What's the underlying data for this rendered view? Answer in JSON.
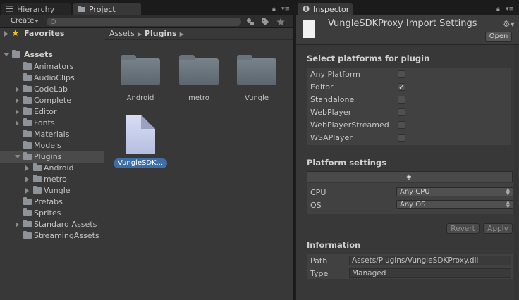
{
  "left_panel": {
    "tabs": [
      {
        "label": "Hierarchy",
        "icon": "list-icon"
      },
      {
        "label": "Project",
        "icon": "folder-icon"
      }
    ],
    "create_label": "Create",
    "search_placeholder": ""
  },
  "tree": {
    "favorites": "Favorites",
    "assets": "Assets",
    "items": [
      "Animators",
      "AudioClips",
      "CodeLab",
      "Complete",
      "Editor",
      "Fonts",
      "Materials",
      "Models",
      "Plugins",
      "Android",
      "metro",
      "Vungle",
      "Prefabs",
      "Sprites",
      "Standard Assets",
      "StreamingAssets"
    ]
  },
  "content": {
    "breadcrumb": [
      "Assets",
      "Plugins"
    ],
    "assets": [
      "Android",
      "metro",
      "Vungle",
      "VungleSDK..."
    ]
  },
  "inspector": {
    "tab_label": "Inspector",
    "title": "VungleSDKProxy Import Settings",
    "open_label": "Open",
    "select_platforms_heading": "Select platforms for plugin",
    "platforms": [
      {
        "label": "Any Platform",
        "checked": false
      },
      {
        "label": "Editor",
        "checked": true
      },
      {
        "label": "Standalone",
        "checked": false
      },
      {
        "label": "WebPlayer",
        "checked": false
      },
      {
        "label": "WebPlayerStreamed",
        "checked": false
      },
      {
        "label": "WSAPlayer",
        "checked": false
      }
    ],
    "checkmark": "✓",
    "platform_settings_heading": "Platform settings",
    "settings": [
      {
        "label": "CPU",
        "value": "Any CPU"
      },
      {
        "label": "OS",
        "value": "Any OS"
      }
    ],
    "revert_label": "Revert",
    "apply_label": "Apply",
    "information_heading": "Information",
    "info": [
      {
        "label": "Path",
        "value": "Assets/Plugins/VungleSDKProxy.dll"
      },
      {
        "label": "Type",
        "value": "Managed"
      }
    ]
  },
  "colors": {
    "panel_bg": "#383838",
    "selection_blue": "#3e6ea8",
    "favorites_star": "#e8c020"
  }
}
